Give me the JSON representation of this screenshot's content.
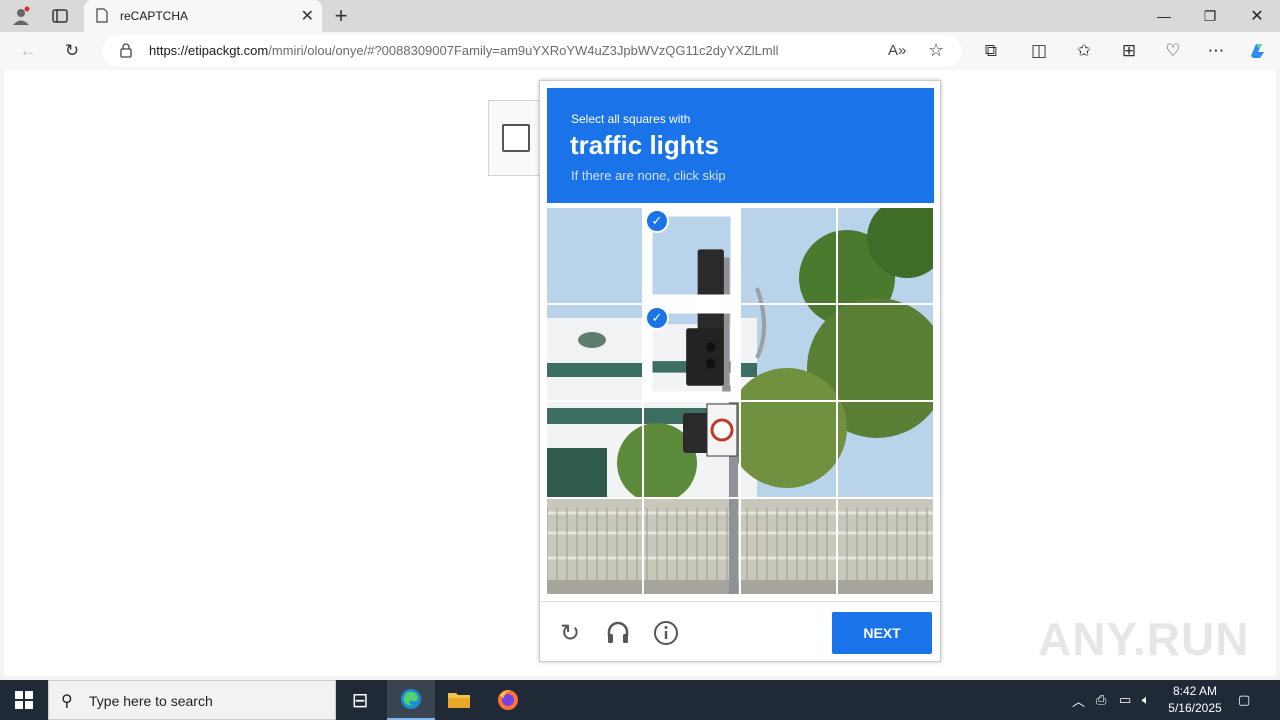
{
  "browser": {
    "tab_title": "reCAPTCHA",
    "url_host": "https://etipackgt.com",
    "url_path": "/mmiri/olou/onye/#?0088309007Family=am9uYXRoYW4uZ3JpbWVzQG11c2dyYXZlLmll"
  },
  "captcha": {
    "prompt_small": "Select all squares with",
    "prompt_target": "traffic lights",
    "prompt_sub": "If there are none, click skip",
    "next_label": "NEXT",
    "selected_tiles": [
      1,
      5
    ],
    "icons": [
      "reload-icon",
      "audio-icon",
      "info-icon"
    ]
  },
  "watermark": "ANY.RUN",
  "taskbar": {
    "search_placeholder": "Type here to search",
    "time": "8:42 AM",
    "date": "5/16/2025"
  },
  "colors": {
    "accent": "#1a73e8"
  }
}
